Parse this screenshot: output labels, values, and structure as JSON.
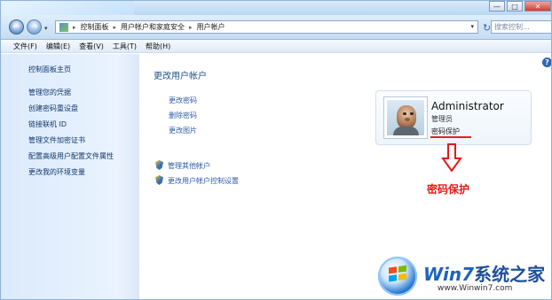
{
  "window": {
    "controls": [
      "—",
      "□",
      "✕"
    ]
  },
  "nav": {
    "back_label": "←",
    "forward_label": "→",
    "dropdown": "▾",
    "breadcrumbs": [
      "控制面板",
      "用户帐户和家庭安全",
      "用户帐户"
    ],
    "separator": "▸",
    "address_dropdown": "▾",
    "refresh": "↻",
    "search_placeholder": "搜索控制..."
  },
  "menubar": {
    "items": [
      "文件(F)",
      "编辑(E)",
      "查看(V)",
      "工具(T)",
      "帮助(H)"
    ]
  },
  "sidebar": {
    "items": [
      "控制面板主页",
      "管理您的凭据",
      "创建密码重设盘",
      "链接联机 ID",
      "管理文件加密证书",
      "配置高级用户配置文件属性",
      "更改我的环境变量"
    ]
  },
  "main": {
    "title": "更改用户帐户",
    "tasks": [
      "更改密码",
      "删除密码",
      "更改图片"
    ],
    "shield_links": [
      "管理其他帐户",
      "更改用户帐户控制设置"
    ],
    "help": "?"
  },
  "account": {
    "name": "Administrator",
    "role": "管理员",
    "password_status": "密码保护"
  },
  "annotation": {
    "text": "密码保护",
    "color": "#e61919"
  },
  "watermark": {
    "brand": "系统之家",
    "w7": "Win7",
    "url": "www.Winwin7.com"
  },
  "icons": {
    "address": "control-panel-icon",
    "search": "search-icon",
    "shield": "shield-icon"
  }
}
